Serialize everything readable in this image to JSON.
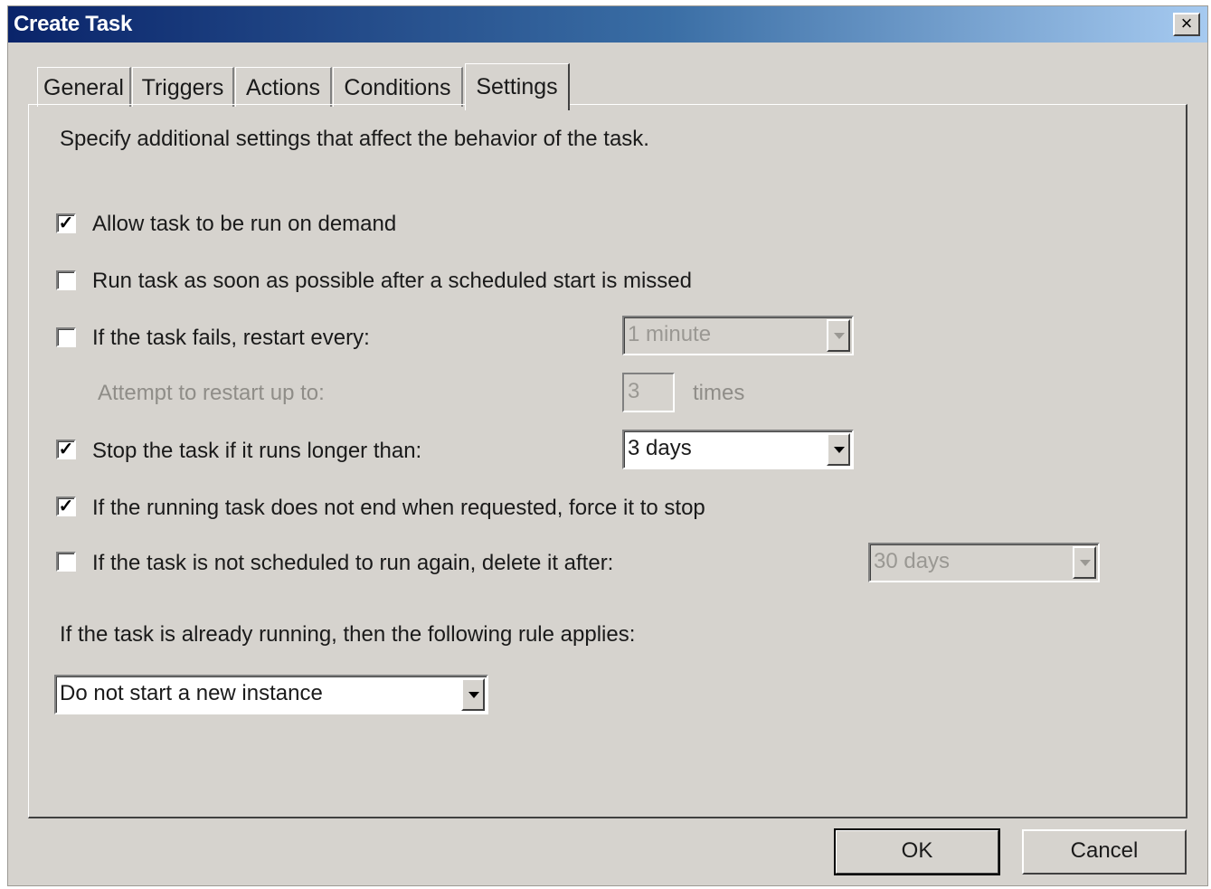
{
  "window": {
    "title": "Create Task",
    "close_label": "×"
  },
  "tabs": [
    {
      "label": "General",
      "active": false
    },
    {
      "label": "Triggers",
      "active": false
    },
    {
      "label": "Actions",
      "active": false
    },
    {
      "label": "Conditions",
      "active": false
    },
    {
      "label": "Settings",
      "active": true
    }
  ],
  "settings": {
    "intro": "Specify additional settings that affect the behavior of the task.",
    "allow_on_demand": {
      "label": "Allow task to be run on demand",
      "checked": true
    },
    "run_asap": {
      "label": "Run task as soon as possible after a scheduled start is missed",
      "checked": false
    },
    "restart_on_fail": {
      "label": "If the task fails, restart every:",
      "checked": false,
      "value": "1 minute"
    },
    "restart_attempts": {
      "label": "Attempt to restart up to:",
      "value": "3",
      "suffix": "times"
    },
    "stop_if_longer": {
      "label": "Stop the task if it runs longer than:",
      "checked": true,
      "value": "3 days"
    },
    "force_stop": {
      "label": "If the running task does not end when requested, force it to stop",
      "checked": true
    },
    "delete_after": {
      "label": "If the task is not scheduled to run again, delete it after:",
      "checked": false,
      "value": "30 days"
    },
    "rule_label": "If the task is already running, then the following rule applies:",
    "rule_value": "Do not start a new instance"
  },
  "buttons": {
    "ok": "OK",
    "cancel": "Cancel"
  },
  "check_glyph": "✓"
}
